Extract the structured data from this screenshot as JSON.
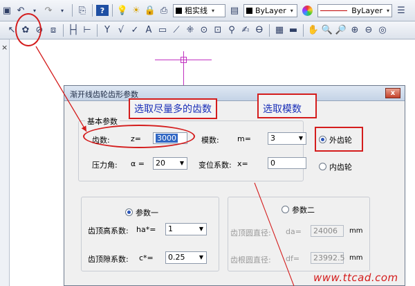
{
  "toolbar": {
    "linetype_label": "粗实线",
    "color_label": "ByLayer",
    "linetype_bylayer": "ByLayer",
    "help_glyph": "?"
  },
  "dialog": {
    "title": "渐开线齿轮齿形参数",
    "close_glyph": "x",
    "basic_group": "基本参数",
    "teeth_label": "齿数:",
    "teeth_symbol": "z=",
    "teeth_value": "3000",
    "module_label": "模数:",
    "module_symbol": "m=",
    "module_value": "3",
    "external_gear": "外齿轮",
    "internal_gear": "内齿轮",
    "pressure_label": "压力角:",
    "pressure_symbol": "α =",
    "pressure_value": "20",
    "shift_label": "变位系数:",
    "shift_symbol": "x=",
    "shift_value": "0",
    "param1_label": "参数一",
    "param2_label": "参数二",
    "addendum_coef_label": "齿顶高系数:",
    "addendum_coef_symbol": "ha*=",
    "addendum_coef_value": "1",
    "clearance_coef_label": "齿顶隙系数:",
    "clearance_coef_symbol": "c*=",
    "clearance_coef_value": "0.25",
    "tip_diameter_label": "齿顶圆直径:",
    "tip_diameter_symbol": "da=",
    "tip_diameter_value": "24006",
    "tip_diameter_unit": "mm",
    "root_diameter_label": "齿根圆直径:",
    "root_diameter_symbol": "df=",
    "root_diameter_value": "23992.5",
    "root_diameter_unit": "mm"
  },
  "annotations": {
    "callout_teeth": "选取尽量多的齿数",
    "callout_module": "选取模数"
  },
  "watermark": "www.ttcad.com",
  "colors": {
    "annotation_red": "#d41c1c",
    "callout_text_blue": "#1a2fb8",
    "crosshair_magenta": "#c030c0",
    "dialog_bg": "#f0f0f0",
    "selected_radio": "#2a55b8"
  },
  "icons": [
    "undo-icon",
    "redo-icon",
    "copy-icon",
    "help-icon",
    "light-bulb-icon",
    "color-wheel-icon",
    "line-weight-icon",
    "select-arrow-icon",
    "gear-shape-icon",
    "zoom-icon",
    "pan-icon"
  ]
}
